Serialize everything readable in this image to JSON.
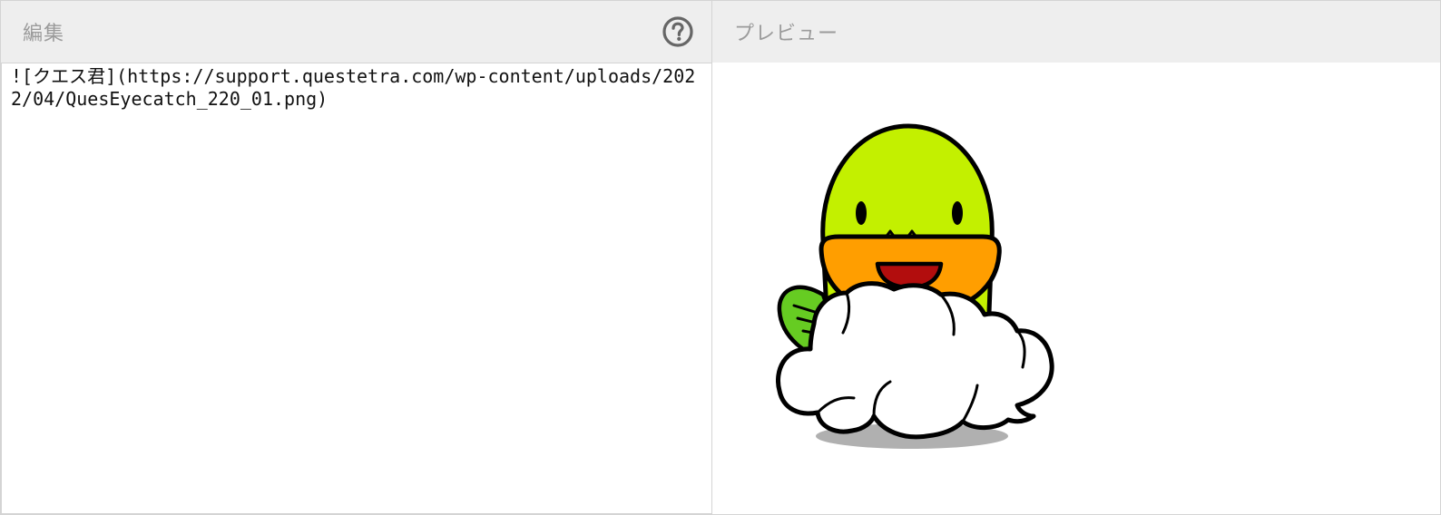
{
  "editor": {
    "header_title": "編集",
    "help_icon": "question-circle-icon",
    "content": "![クエス君](https://support.questetra.com/wp-content/uploads/2022/04/QuesEyecatch_220_01.png)"
  },
  "preview": {
    "header_title": "プレビュー",
    "image_description": "クエス君"
  },
  "colors": {
    "header_bg": "#eeeeee",
    "header_text": "#9b9b9b",
    "border": "#d4d4d4",
    "icon": "#666666",
    "mascot_body": "#c3f000",
    "mascot_mouth_area": "#ff9e00",
    "mascot_fin": "#66cc22",
    "mascot_tongue": "#b20d0d"
  }
}
